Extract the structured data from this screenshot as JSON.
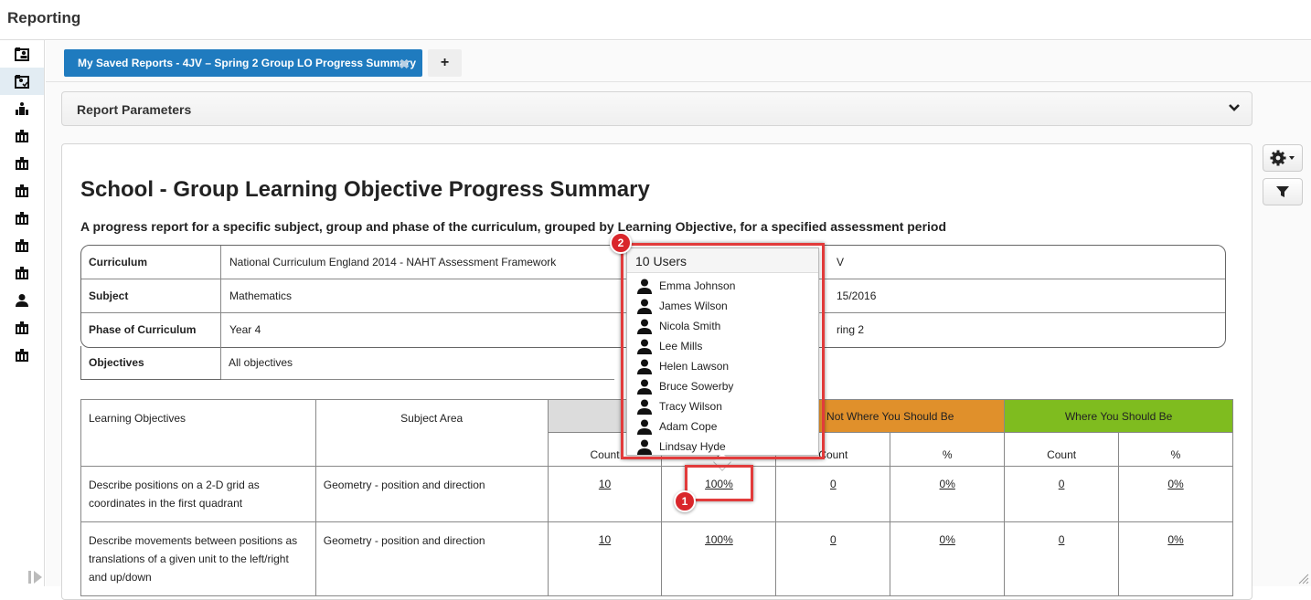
{
  "app": {
    "title": "Reporting"
  },
  "sidebar": {
    "items": [
      {
        "icon": "user-report-icon"
      },
      {
        "icon": "user-report-check-icon",
        "active": true
      },
      {
        "icon": "school-group-icon"
      },
      {
        "icon": "building-icon"
      },
      {
        "icon": "building-icon"
      },
      {
        "icon": "building-icon"
      },
      {
        "icon": "building-icon"
      },
      {
        "icon": "building-icon"
      },
      {
        "icon": "building-icon"
      },
      {
        "icon": "person-icon"
      },
      {
        "icon": "building-icon"
      },
      {
        "icon": "building-icon"
      }
    ]
  },
  "tabs": {
    "active_label": "My Saved Reports - 4JV – Spring 2 Group LO Progress Summary",
    "close_symbol": "✖",
    "add_symbol": "+"
  },
  "params": {
    "label": "Report Parameters"
  },
  "report": {
    "title": "School - Group Learning Objective Progress Summary",
    "subtitle": "A progress report for a specific subject, group and phase of the curriculum, grouped by Learning Objective, for a specified assessment period",
    "parameters": [
      {
        "key": "Curriculum",
        "value": "National Curriculum England 2014 - NAHT Assessment Framework",
        "value2": "V"
      },
      {
        "key": "Subject",
        "value": "Mathematics",
        "value2": "15/2016"
      },
      {
        "key": "Phase of Curriculum",
        "value": "Year 4",
        "value2": "ring 2"
      },
      {
        "key": "Objectives",
        "value": "All objectives"
      }
    ],
    "table": {
      "headers": {
        "learning_objectives": "Learning Objectives",
        "subject_area": "Subject Area",
        "group_not_where": "Not Where You Should Be",
        "group_where": "Where You Should Be",
        "count": "Count",
        "percent": "%"
      },
      "rows": [
        {
          "objective": "Describe positions on a 2-D grid as coordinates in the first quadrant",
          "area": "Geometry - position and direction",
          "c1": "10",
          "p1": "100%",
          "c2": "0",
          "p2": "0%",
          "c3": "0",
          "p3": "0%"
        },
        {
          "objective": "Describe movements between positions as translations of a given unit to the left/right and up/down",
          "area": "Geometry - position and direction",
          "c1": "10",
          "p1": "100%",
          "c2": "0",
          "p2": "0%",
          "c3": "0",
          "p3": "0%"
        }
      ]
    }
  },
  "popover": {
    "title": "10 Users",
    "users": [
      "Emma Johnson",
      "James Wilson",
      "Nicola Smith",
      "Lee Mills",
      "Helen Lawson",
      "Bruce Sowerby",
      "Tracy Wilson",
      "Adam Cope",
      "Lindsay Hyde"
    ]
  },
  "annotations": {
    "badge1": "1",
    "badge2": "2"
  },
  "colors": {
    "accent": "#1f7bbf",
    "orange": "#e0902b",
    "green": "#7fbc1f",
    "highlight": "#e23b3b"
  }
}
